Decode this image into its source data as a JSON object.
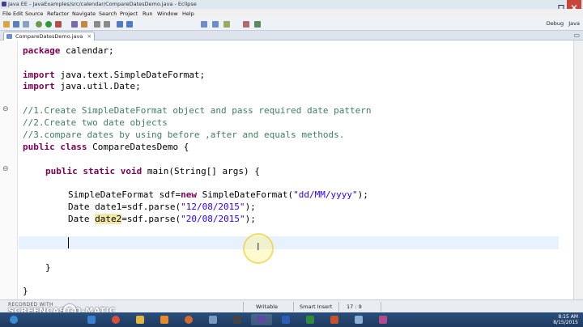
{
  "window": {
    "title": "Java EE - JavaExamples/src/calendar/CompareDatesDemo.java - Eclipse"
  },
  "menu": [
    "File",
    "Edit",
    "Source",
    "Refactor",
    "Navigate",
    "Search",
    "Project",
    "Run",
    "Window",
    "Help"
  ],
  "toolbar": {
    "perspectives": [
      "Debug",
      "Java"
    ]
  },
  "editor": {
    "tab_label": "CompareDatesDemo.java",
    "code": {
      "package_kw": "package",
      "package_rest": " calendar;",
      "import_kw": "import",
      "import1_rest": " java.text.SimpleDateFormat;",
      "import2_rest": " java.util.Date;",
      "comment1": "//1.Create SimpleDateFormat object and pass required date pattern",
      "comment2": "//2.Create two date objects",
      "comment3": "//3.compare dates by using before ,after and equals methods.",
      "class_kw": "public class",
      "class_rest": " CompareDatesDemo {",
      "main_kw": "public static void",
      "main_rest": " main(String[] args) {",
      "sdf_a": "SimpleDateFormat sdf=",
      "sdf_new": "new",
      "sdf_b": " SimpleDateFormat(",
      "sdf_str": "\"dd/MM/yyyy\"",
      "sdf_c": ");",
      "date1_a": "Date date1=sdf.parse(",
      "date1_str": "\"12/08/2015\"",
      "date1_c": ");",
      "date2_a": "Date ",
      "date2_var": "date2",
      "date2_b": "=sdf.parse(",
      "date2_str": "\"20/08/2015\"",
      "date2_c": ");",
      "close_method": "}",
      "close_class": "}"
    },
    "cursor_glyph": "I"
  },
  "status": {
    "writable": "Writable",
    "insert_mode": "Smart Insert",
    "position": "17 : 9"
  },
  "watermark": {
    "recorded": "RECORDED WITH",
    "brand": "SCREENCAST-O-MATIC"
  },
  "taskbar": {
    "time": "8:15 AM",
    "date": "8/15/2015"
  },
  "colors": {
    "keyword": "#7f0055",
    "comment": "#3f7f5f",
    "string": "#2a00ff",
    "current_line": "#e8f2fe",
    "taskbar": "#1d3a60"
  },
  "icons": [
    "minimize-icon",
    "maximize-icon",
    "close-icon",
    "new-icon",
    "save-icon",
    "debug-icon",
    "run-icon",
    "search-icon",
    "java-file-icon"
  ]
}
